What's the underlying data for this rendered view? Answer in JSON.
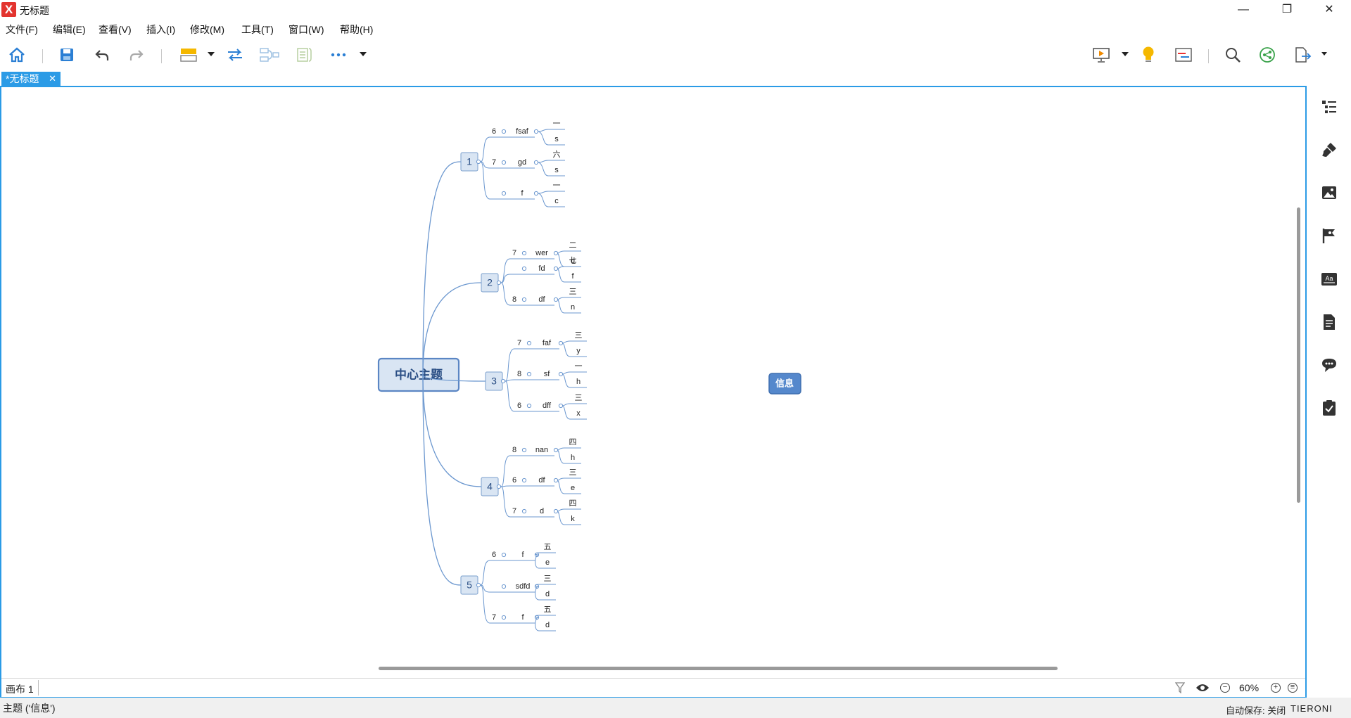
{
  "window": {
    "title": "无标题",
    "logo_glyph": "X",
    "minimize": "—",
    "restore": "❐",
    "close": "✕"
  },
  "menu": [
    "文件(F)",
    "编辑(E)",
    "查看(V)",
    "插入(I)",
    "修改(M)",
    "工具(T)",
    "窗口(W)",
    "帮助(H)"
  ],
  "toolbar": {
    "left_icons": [
      "home-icon",
      "save-icon",
      "undo-icon",
      "redo-icon",
      "topic-style-icon",
      "relationship-icon",
      "summary-icon",
      "boundary-icon",
      "more-icon"
    ],
    "right_icons": [
      "presentation-icon",
      "lightbulb-icon",
      "gantt-icon",
      "search-icon",
      "share-icon",
      "export-icon"
    ]
  },
  "tab": {
    "label": "*无标题",
    "close_glyph": "✕"
  },
  "mindmap": {
    "central": "中心主题",
    "floating": "信息",
    "branches": [
      {
        "label": "1",
        "children": [
          {
            "num": "6",
            "label": "fsaf",
            "leaves": [
              "一",
              "s"
            ]
          },
          {
            "num": "7",
            "label": "gd",
            "leaves": [
              "六",
              "s"
            ]
          },
          {
            "num": "",
            "label": "f",
            "leaves": [
              "一",
              "c"
            ]
          }
        ]
      },
      {
        "label": "2",
        "children": [
          {
            "num": "7",
            "label": "wer",
            "leaves": [
              "二",
              "d"
            ]
          },
          {
            "num": "",
            "label": "fd",
            "leaves": [
              "七",
              "f"
            ]
          },
          {
            "num": "8",
            "label": "df",
            "leaves": [
              "三",
              "n"
            ]
          }
        ]
      },
      {
        "label": "3",
        "children": [
          {
            "num": "7",
            "label": "faf",
            "leaves": [
              "三",
              "y"
            ]
          },
          {
            "num": "8",
            "label": "sf",
            "leaves": [
              "一",
              "h"
            ]
          },
          {
            "num": "6",
            "label": "dff",
            "leaves": [
              "三",
              "x"
            ]
          }
        ]
      },
      {
        "label": "4",
        "children": [
          {
            "num": "8",
            "label": "nan",
            "leaves": [
              "四",
              "h"
            ]
          },
          {
            "num": "6",
            "label": "df",
            "leaves": [
              "三",
              "e"
            ]
          },
          {
            "num": "7",
            "label": "d",
            "leaves": [
              "四",
              "k"
            ]
          }
        ]
      },
      {
        "label": "5",
        "children": [
          {
            "num": "6",
            "label": "f",
            "leaves": [
              "五",
              "e"
            ]
          },
          {
            "num": "",
            "label": "sdfd",
            "leaves": [
              "三",
              "d"
            ]
          },
          {
            "num": "7",
            "label": "f",
            "leaves": [
              "五",
              "d"
            ]
          }
        ]
      }
    ]
  },
  "sheetbar": {
    "sheet": "画布 1",
    "zoom": "60%",
    "zoom_out": "−",
    "zoom_in": "+",
    "fit": "≡"
  },
  "status": {
    "left": "主题 ('信息')",
    "autosave": "自动保存: 关闭",
    "tiers": "TIERONI"
  },
  "right_panel": [
    "outline-icon",
    "format-brush-icon",
    "image-icon",
    "marker-flag-icon",
    "text-style-icon",
    "notes-icon",
    "comment-icon",
    "task-icon"
  ],
  "colors": {
    "accent": "#2b9be6",
    "node_fill": "#d9e5f3",
    "node_border": "#7a9fcc",
    "line": "#6b97cf",
    "central_border": "#5b86c4",
    "floating_fill": "#5588cc"
  }
}
